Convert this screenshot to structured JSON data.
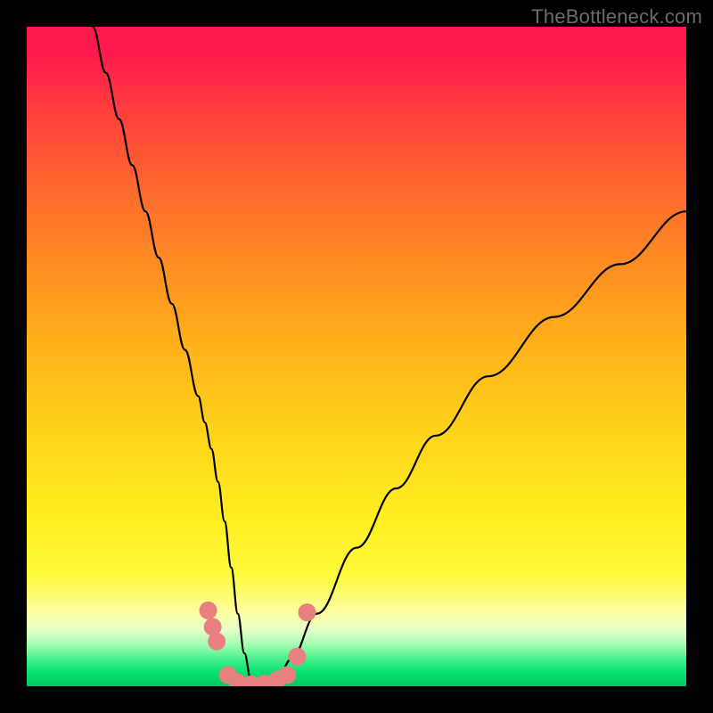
{
  "watermark": "TheBottleneck.com",
  "colors": {
    "frame": "#000000",
    "curve_stroke": "#000000",
    "marker_fill": "#e98080",
    "gradient_top": "#ff1a4d",
    "gradient_bottom": "#03c85f"
  },
  "chart_data": {
    "type": "line",
    "title": "",
    "xlabel": "",
    "ylabel": "",
    "xlim": [
      0,
      100
    ],
    "ylim": [
      0,
      100
    ],
    "grid": false,
    "legend": false,
    "series": [
      {
        "name": "bottleneck-curve",
        "x": [
          10,
          12,
          14,
          16,
          18,
          20,
          22,
          24,
          26,
          27,
          28,
          29,
          30,
          31,
          32,
          33,
          34,
          35,
          37,
          38,
          40,
          44,
          50,
          56,
          62,
          70,
          80,
          90,
          100
        ],
        "y": [
          100,
          93,
          86,
          79,
          72,
          65,
          58,
          51,
          44,
          40,
          36,
          31,
          25,
          18,
          11,
          5,
          1,
          0,
          0,
          1,
          4,
          11,
          21,
          30,
          38,
          47,
          56,
          64,
          72
        ]
      }
    ],
    "markers": [
      {
        "x": 27.5,
        "y": 11.5
      },
      {
        "x": 28.2,
        "y": 9.0
      },
      {
        "x": 28.8,
        "y": 6.8
      },
      {
        "x": 30.5,
        "y": 1.7
      },
      {
        "x": 32.0,
        "y": 0.6
      },
      {
        "x": 34.0,
        "y": 0.3
      },
      {
        "x": 36.0,
        "y": 0.4
      },
      {
        "x": 38.0,
        "y": 1.0
      },
      {
        "x": 39.5,
        "y": 1.7
      },
      {
        "x": 41.0,
        "y": 4.5
      },
      {
        "x": 42.5,
        "y": 11.2
      }
    ]
  }
}
